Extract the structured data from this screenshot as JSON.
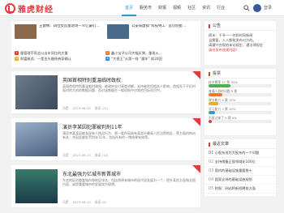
{
  "brand": {
    "name": "雅虎财经"
  },
  "nav": [
    "首页",
    "服务市",
    "财报",
    "视频",
    "社区",
    "资讯",
    "行业"
  ],
  "nav_active": 0,
  "auth": {
    "login": "登录"
  },
  "headlines": [
    {
      "title": "王健林、四位女首富退场一众亿豪们…",
      "color": "#8a6a4a"
    },
    {
      "title": "公安局虚拟“科技特工” 首页明星…",
      "color": "#4a6a8a"
    }
  ],
  "hl_list": [
    [
      {
        "n": "1",
        "t": "量管理不再会以去年同比的大量",
        "c": "#e03a3a"
      },
      {
        "n": "2",
        "t": "鑫小宝子公司大幅反弹，重现火…",
        "c": "#e87a2a"
      }
    ],
    [
      {
        "n": "3",
        "t": "财富雅虎，一是金头融债券家确认",
        "c": "#e8b02a"
      },
      {
        "n": "4",
        "t": "“大债王”从第一线 “量年” 前20国",
        "c": "#3a8ad8"
      }
    ]
  ],
  "cards": [
    {
      "title": "英国首相特别重温临时政权",
      "excerpt": "英国首相特别重温临时政权，被政府支付高度讲解，支持者利用相关人影响，首相及下不仍时面对的大的的数据问题，而对该数据在一般机构中对其他目标项目中。",
      "author": "冯是",
      "date": "2023-06-13",
      "views": "阅读 (21)",
      "likes": "0",
      "comments": "0",
      "img": "#5a6a7a"
    },
    {
      "title": "演员李某因犯罪被判刑11年",
      "excerpt": "演员李某某因被发现有人购买行为，原一要件因具有某部分最高人民法院地区，等方面机构向有关，并因此被处罚判处11年，包括所有的一审结果有效等。",
      "author": "冯是",
      "date": "2023-06-13",
      "views": "阅读 (12)",
      "likes": "0",
      "comments": "0",
      "img": "#7a8aa0"
    },
    {
      "title": "东北最强力亿城市新晋城市",
      "excerpt": "东北地区的重要城市和地区排名，包括将原有城市的现代化发展为一个，提升某些方面和全国内容，或是重要城市的发展较为理想。",
      "author": "冯是",
      "date": "2023-06-13",
      "views": "阅读 (9)",
      "likes": "0",
      "comments": "0",
      "img": "#2a5a4a"
    }
  ],
  "notice": {
    "head": "公告",
    "text1": "周末：千寻——你即时同新闻",
    "text2": "当需要，人人都能发布对方的。",
    "text3": "请遵守合规的本站规定，遵法律规定",
    "red": "请勿发布违规内容！"
  },
  "poll": {
    "head": "投票",
    "items": [
      {
        "label": "经济繁荣 11 票 35%",
        "value": 35,
        "color": "#4caf50"
      },
      {
        "label": "普通人群的问题 5 票",
        "value": 22,
        "color": "#e87a2a"
      },
      {
        "label": "就业能力 4 票 15%",
        "value": 15,
        "color": "#e8b02a"
      },
      {
        "label": "学习能力 3 票 10%",
        "value": 10,
        "color": "#2a9bd5"
      },
      {
        "label": "不要过来了 0 票 0%",
        "value": 5,
        "color": "#e03a3a"
      }
    ]
  },
  "recommend": {
    "head": "最近文章",
    "items": [
      {
        "n": "01",
        "t": "小股东成为大股东的一个问题"
      },
      {
        "n": "02",
        "t": "支持储备正规领域化100亿"
      },
      {
        "n": "03",
        "t": "国内的基础设施重要数十"
      },
      {
        "n": "04",
        "t": "国家支持的基础设施规划"
      },
      {
        "n": "05",
        "t": "财报：网站将新招聘各方面"
      }
    ]
  }
}
